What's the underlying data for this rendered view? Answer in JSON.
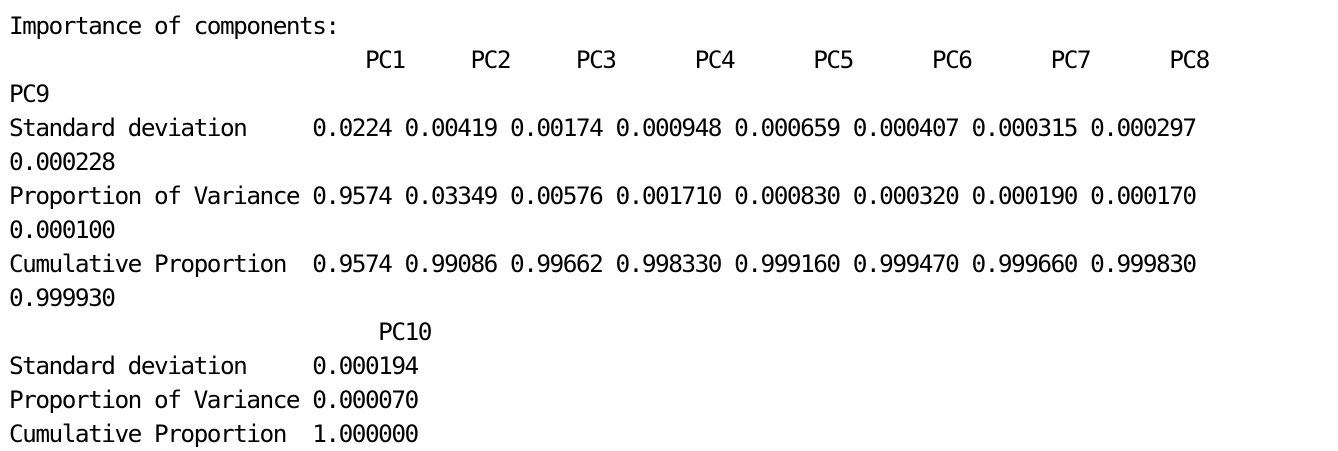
{
  "console": {
    "lines": [
      "Importance of components:",
      "                           PC1     PC2     PC3      PC4      PC5      PC6      PC7      PC8",
      "PC9",
      "Standard deviation     0.0224 0.00419 0.00174 0.000948 0.000659 0.000407 0.000315 0.000297",
      "0.000228",
      "Proportion of Variance 0.9574 0.03349 0.00576 0.001710 0.000830 0.000320 0.000190 0.000170",
      "0.000100",
      "Cumulative Proportion  0.9574 0.99086 0.99662 0.998330 0.999160 0.999470 0.999660 0.999830",
      "0.999930",
      "                            PC10",
      "Standard deviation     0.000194",
      "Proportion of Variance 0.000070",
      "Cumulative Proportion  1.000000"
    ]
  }
}
